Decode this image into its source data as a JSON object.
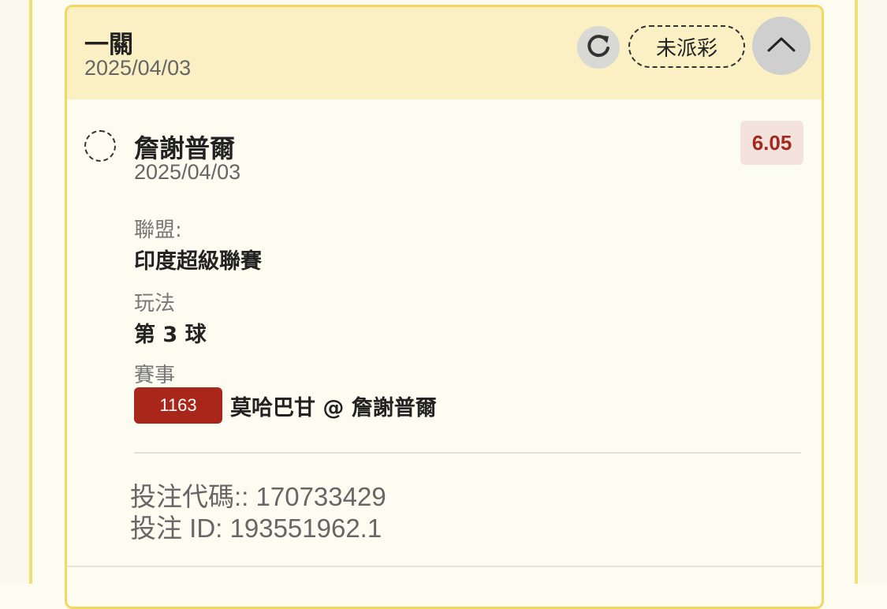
{
  "header": {
    "title": "一關",
    "date": "2025/04/03",
    "status": "未派彩"
  },
  "selection": {
    "name": "詹謝普爾",
    "date": "2025/04/03",
    "odds": "6.05"
  },
  "details": {
    "league_label": "聯盟:",
    "league_value": "印度超級聯賽",
    "market_label": "玩法",
    "market_value": "第 3 球",
    "match_label": "賽事",
    "match_id": "1163",
    "match_name": "莫哈巴甘 @ 詹謝普爾"
  },
  "bet": {
    "code_line": "投注代碼:: 170733429",
    "id_line": "投注 ID: 193551962.1"
  },
  "icons": {
    "refresh": "refresh-icon",
    "collapse": "chevron-up-icon",
    "radio": "radio-icon"
  },
  "colors": {
    "accent": "#f2d761",
    "header_bg": "#fbf0c3",
    "odds_text": "#a42a1f",
    "match_badge": "#a9261a"
  }
}
